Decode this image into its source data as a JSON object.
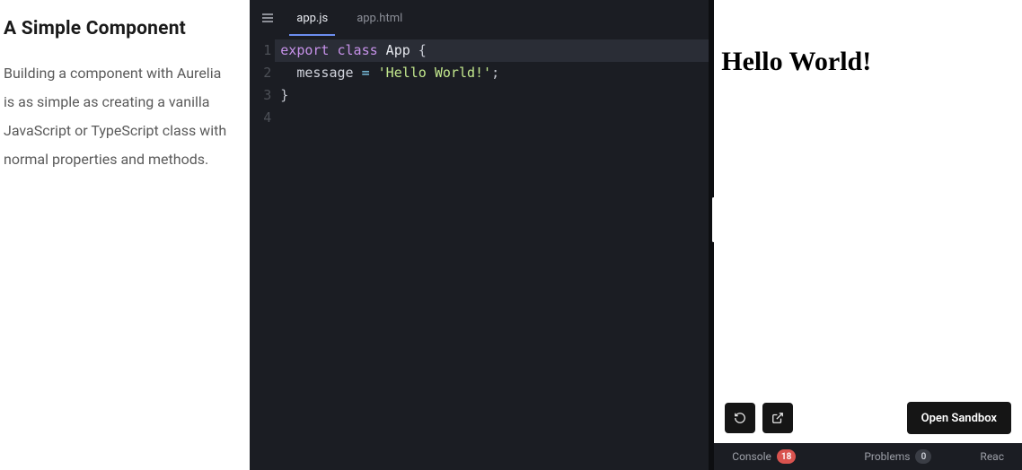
{
  "left": {
    "title": "A Simple Component",
    "description": "Building a component with Aurelia is as simple as creating a vanilla JavaScript or TypeScript class with normal properties and methods."
  },
  "editor": {
    "tabs": [
      {
        "label": "app.js",
        "active": true
      },
      {
        "label": "app.html",
        "active": false
      }
    ],
    "lineNumbers": [
      "1",
      "2",
      "3",
      "4"
    ],
    "code": {
      "l1": {
        "kw1": "export",
        "kw2": "class",
        "cls": "App",
        "open": "{"
      },
      "l2": {
        "indent": "  ",
        "prop": "message",
        "eq": " = ",
        "str": "'Hello World!'",
        "semi": ";"
      },
      "l3": {
        "close": "}"
      }
    }
  },
  "preview": {
    "output": "Hello World!",
    "openSandbox": "Open Sandbox"
  },
  "bottomBar": {
    "console": {
      "label": "Console",
      "count": "18"
    },
    "problems": {
      "label": "Problems",
      "count": "0"
    },
    "react": {
      "label": "Reac"
    }
  }
}
